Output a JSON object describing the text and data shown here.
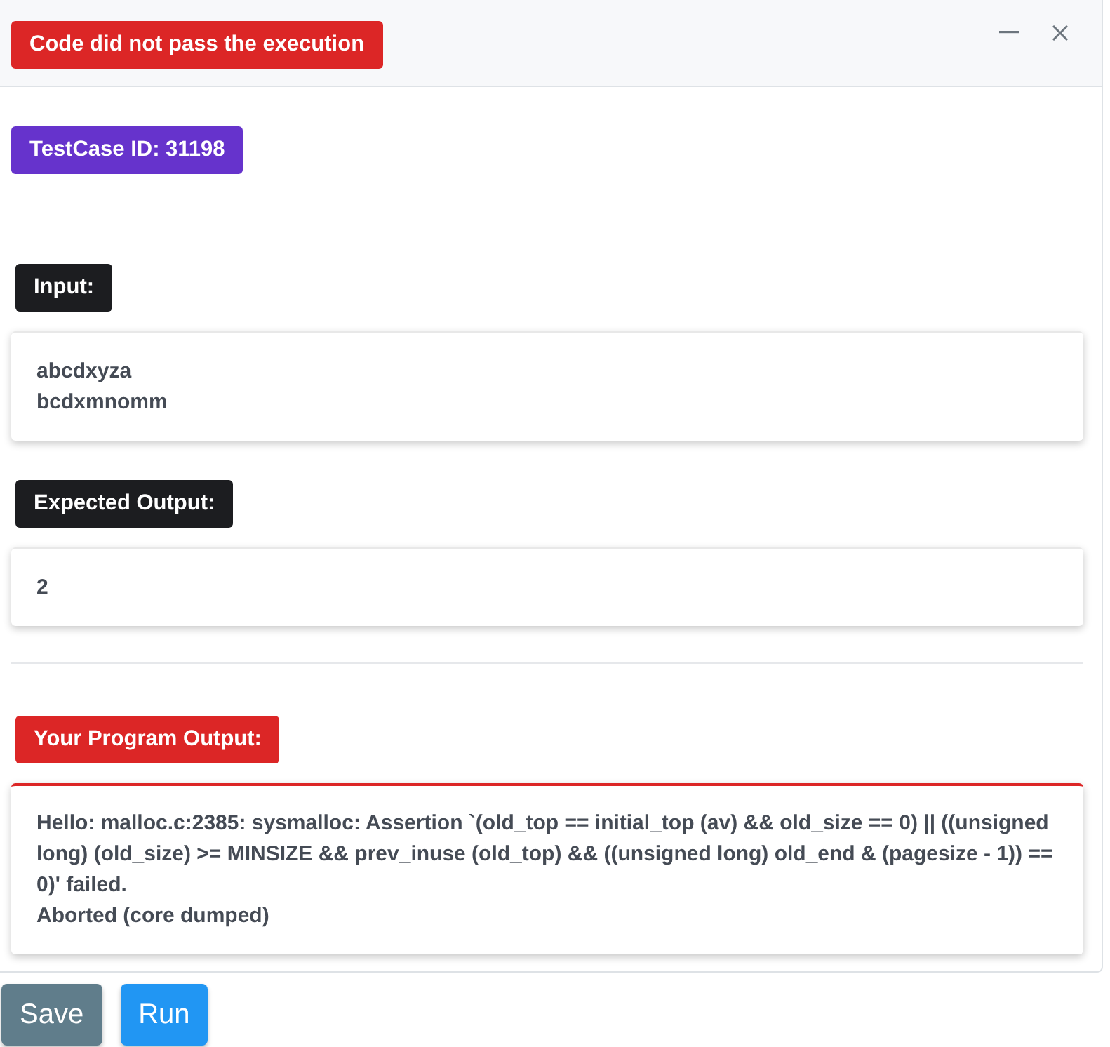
{
  "status": {
    "text": "Code did not pass the execution",
    "passed": false
  },
  "window_controls": [
    {
      "kind": "minimize"
    },
    {
      "kind": "close"
    }
  ],
  "testcase": {
    "label": "TestCase ID: 31198"
  },
  "reference": [
    {
      "label": "Input:",
      "content": "abcdxyza\nbcdxmnomm"
    },
    {
      "label": "Expected Output:",
      "content": "2"
    }
  ],
  "result": {
    "label": "Your Program Output:",
    "passed": false,
    "content": "Hello: malloc.c:2385: sysmalloc: Assertion `(old_top == initial_top (av) && old_size == 0) || ((unsigned long) (old_size) >= MINSIZE && prev_inuse (old_top) && ((unsigned long) old_end & (pagesize - 1)) == 0)' failed.\nAborted (core dumped)"
  },
  "buttons": [
    {
      "label": "Save",
      "kind": "secondary"
    },
    {
      "label": "Run",
      "kind": "primary"
    }
  ]
}
